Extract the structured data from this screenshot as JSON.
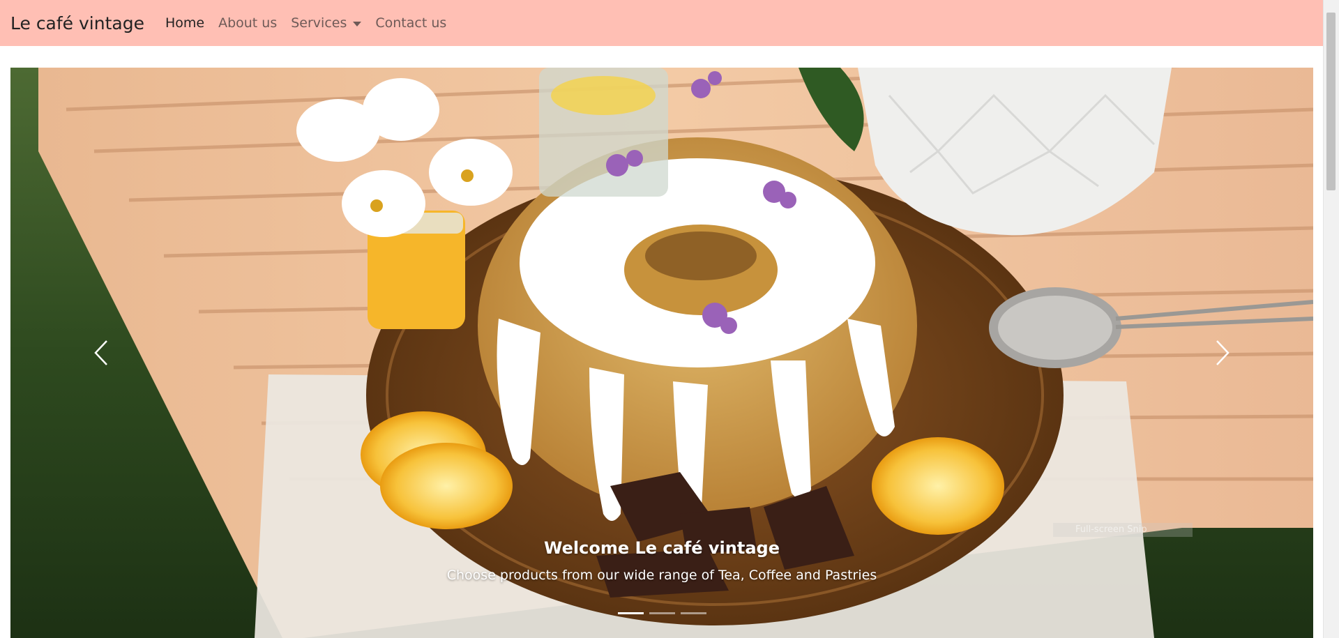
{
  "navbar": {
    "brand": "Le café vintage",
    "links": [
      {
        "label": "Home",
        "active": true
      },
      {
        "label": "About us",
        "active": false
      },
      {
        "label": "Services",
        "active": false,
        "dropdown": true
      },
      {
        "label": "Contact us",
        "active": false
      }
    ],
    "background": "#ffbfb4"
  },
  "carousel": {
    "caption_title": "Welcome Le café vintage",
    "caption_text": "Choose products from our wide range of Tea, Coffee and Pastries",
    "indicators": [
      true,
      false,
      false
    ],
    "prev_icon": "chevron-left-icon",
    "next_icon": "chevron-right-icon",
    "overlay_text": "Full-screen Snip"
  }
}
